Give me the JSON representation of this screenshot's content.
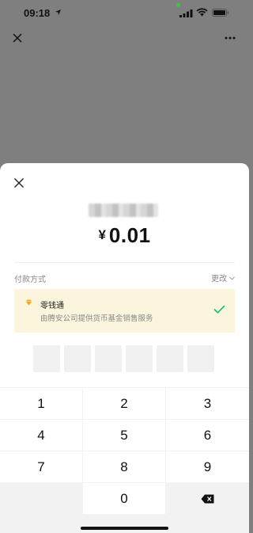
{
  "status_bar": {
    "time": "09:18"
  },
  "background_nav": {
    "close_icon": "close-icon",
    "more_icon": "more-icon"
  },
  "sheet": {
    "amount_currency": "¥",
    "amount_value": "0.01",
    "payment_method_label": "付款方式",
    "change_label": "更改",
    "method": {
      "name": "零钱通",
      "description": "由腾安公司提供货币基金销售服务",
      "selected": true
    },
    "pin_length": 6
  },
  "keypad": {
    "keys": [
      "1",
      "2",
      "3",
      "4",
      "5",
      "6",
      "7",
      "8",
      "9",
      "",
      "0",
      "delete"
    ]
  },
  "colors": {
    "overlay": "#7f7f7f",
    "card_bg": "#fcf5dd",
    "check_green": "#07c160",
    "diamond_gold": "#f0a81c"
  }
}
